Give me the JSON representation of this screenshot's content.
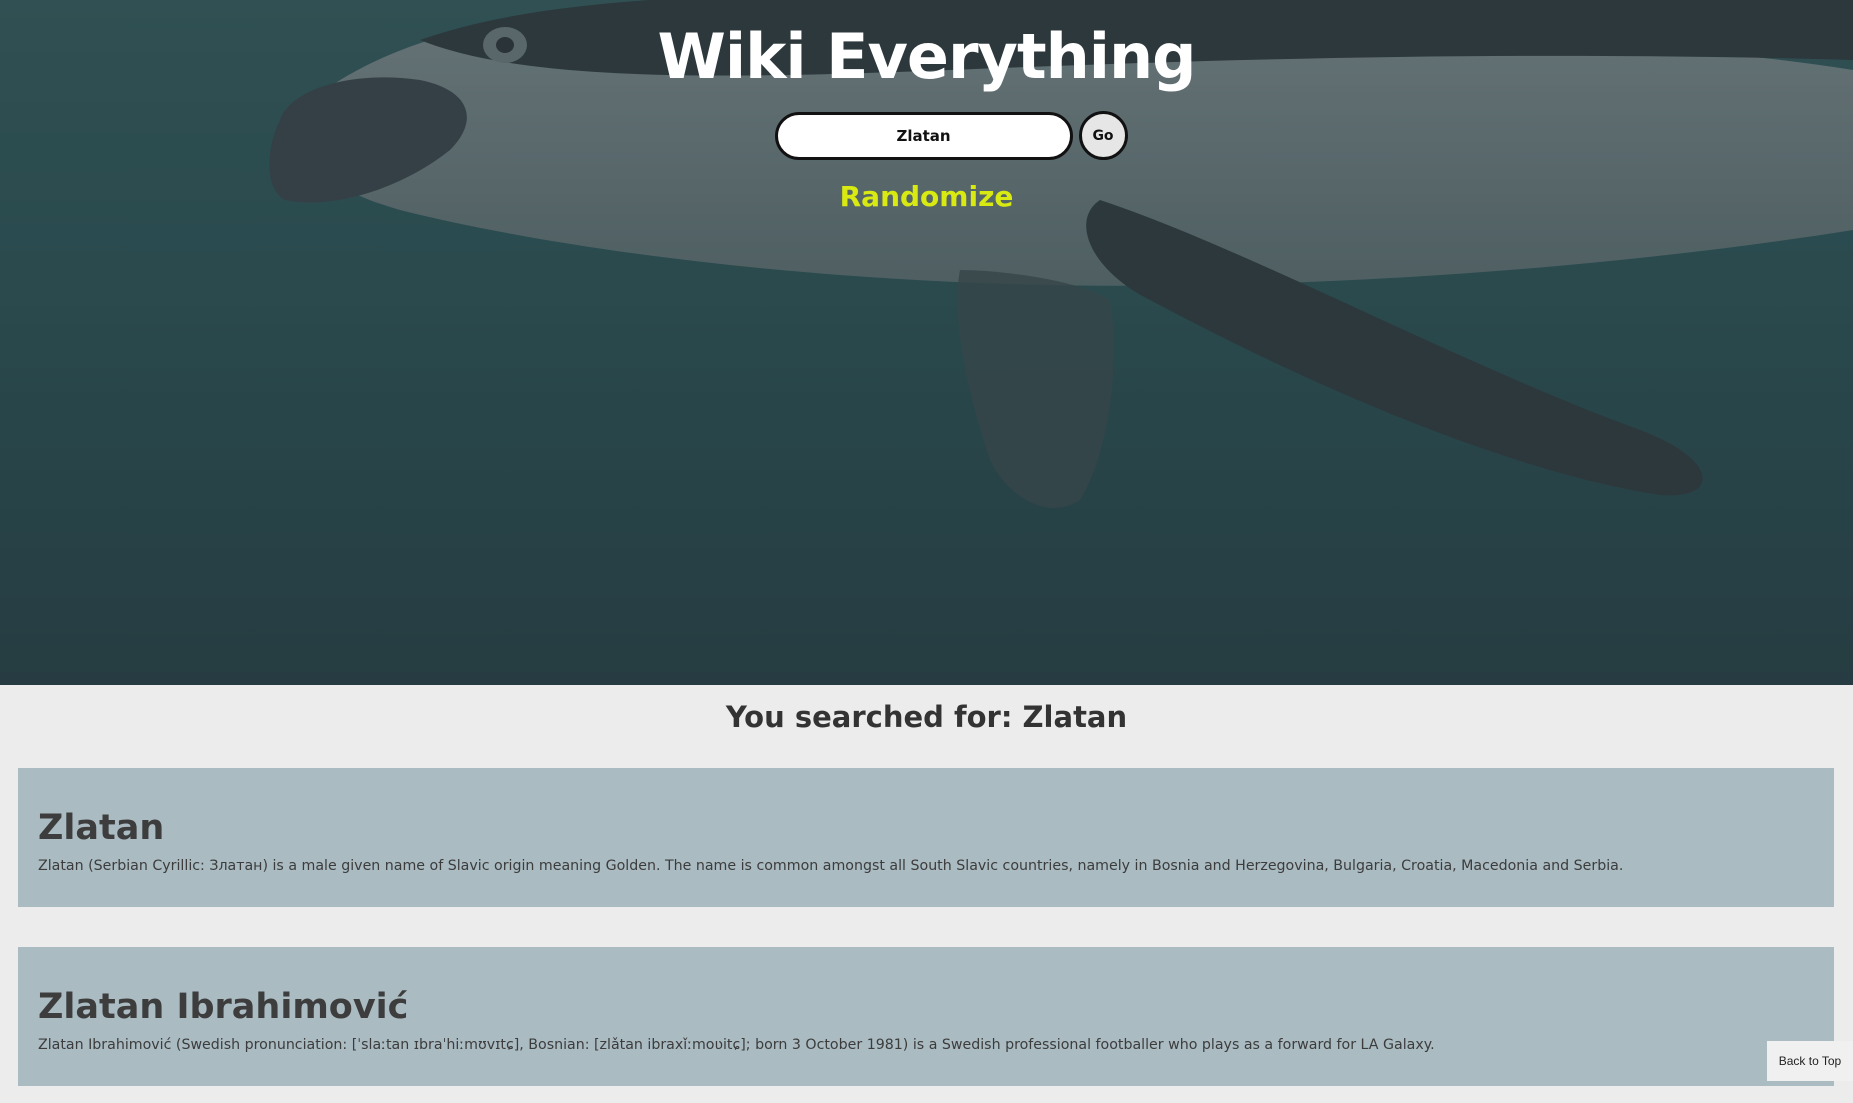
{
  "site": {
    "title": "Wiki Everything"
  },
  "search": {
    "value": "Zlatan",
    "go_label": "Go"
  },
  "randomize_label": "Randomize",
  "results": {
    "heading": "You searched for: Zlatan",
    "items": [
      {
        "title": "Zlatan",
        "snippet": "Zlatan (Serbian Cyrillic: Златан) is a male given name of Slavic origin meaning Golden. The name is common amongst all South Slavic countries, namely in Bosnia and Herzegovina, Bulgaria, Croatia, Macedonia and Serbia."
      },
      {
        "title": "Zlatan Ibrahimović",
        "snippet": "Zlatan Ibrahimović (Swedish pronunciation: [ˈslaːtan ɪbraˈhiːmʊvɪtɕ], Bosnian: [zlǎtan ibraxǐːmoʋitɕ]; born 3 October 1981) is a Swedish professional footballer who plays as a forward for LA Galaxy."
      }
    ]
  },
  "back_to_top_label": "Back to Top",
  "colors": {
    "randomize": "#d8ea12",
    "card_background": "#aabbc2",
    "page_background": "#ececec"
  }
}
